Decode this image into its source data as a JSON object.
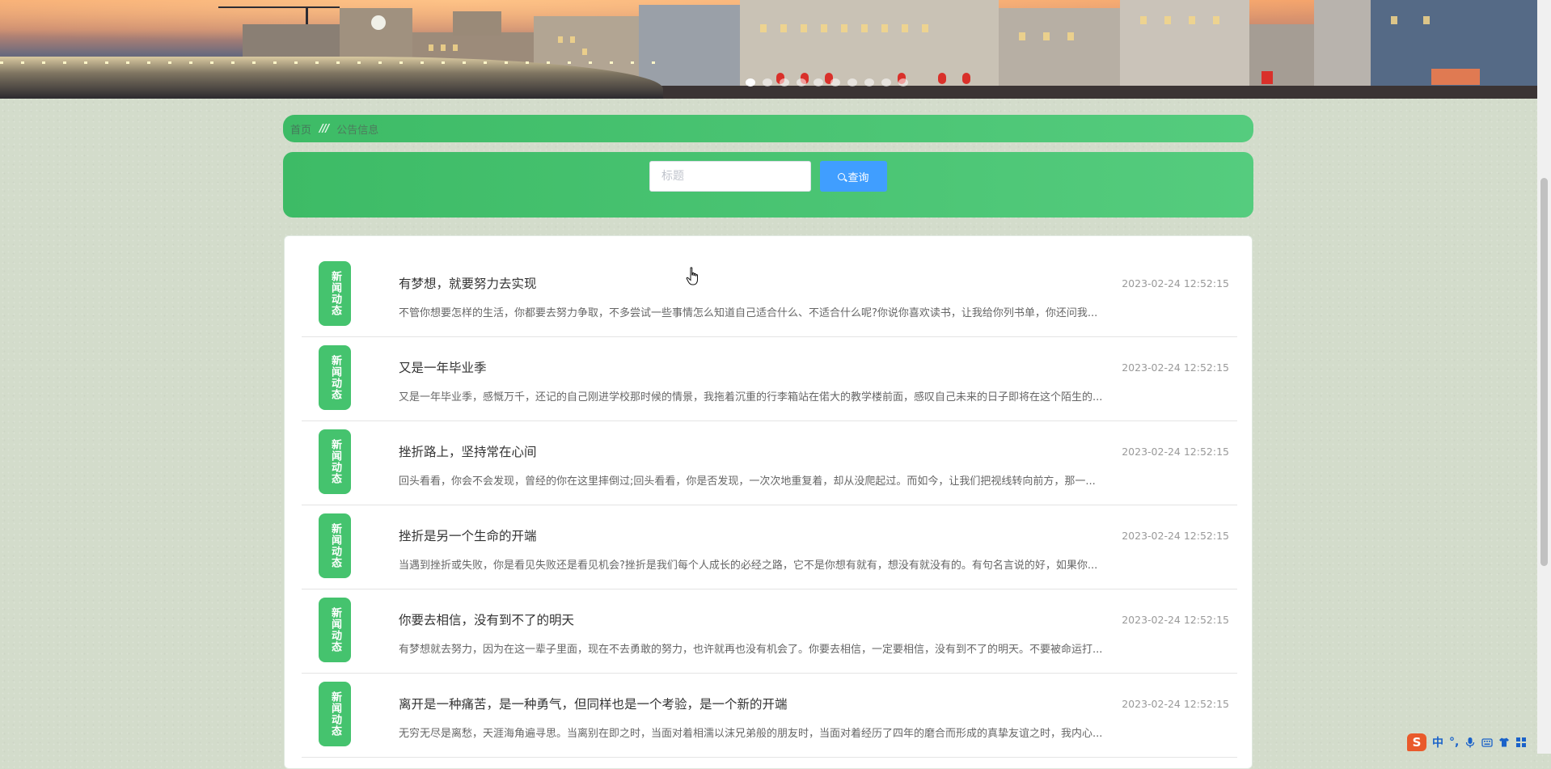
{
  "breadcrumb": {
    "home": "首页",
    "separator": "///",
    "current": "公告信息"
  },
  "search": {
    "placeholder": "标题",
    "value": "",
    "button_label": "查询"
  },
  "carousel": {
    "slide_count": 10,
    "active_index": 0
  },
  "news": {
    "items": [
      {
        "badge": "新闻动态",
        "title": "有梦想，就要努力去实现",
        "date": "2023-02-24 12:52:15",
        "summary": "不管你想要怎样的生活，你都要去努力争取，不多尝试一些事情怎么知道自己适合什么、不适合什么呢?你说你喜欢读书，让我给你列书单，你还问我..."
      },
      {
        "badge": "新闻动态",
        "title": "又是一年毕业季",
        "date": "2023-02-24 12:52:15",
        "summary": "又是一年毕业季，感慨万千，还记的自己刚进学校那时候的情景，我拖着沉重的行李箱站在偌大的教学楼前面，感叹自己未来的日子即将在这个陌生的..."
      },
      {
        "badge": "新闻动态",
        "title": "挫折路上，坚持常在心间",
        "date": "2023-02-24 12:52:15",
        "summary": "回头看看，你会不会发现，曾经的你在这里摔倒过;回头看看，你是否发现，一次次地重复着，却从没爬起过。而如今，让我们把视线转向前方，那一..."
      },
      {
        "badge": "新闻动态",
        "title": "挫折是另一个生命的开端",
        "date": "2023-02-24 12:52:15",
        "summary": "当遇到挫折或失败，你是看见失败还是看见机会?挫折是我们每个人成长的必经之路，它不是你想有就有，想没有就没有的。有句名言说的好，如果你..."
      },
      {
        "badge": "新闻动态",
        "title": "你要去相信，没有到不了的明天",
        "date": "2023-02-24 12:52:15",
        "summary": "有梦想就去努力，因为在这一辈子里面，现在不去勇敢的努力，也许就再也没有机会了。你要去相信，一定要相信，没有到不了的明天。不要被命运打..."
      },
      {
        "badge": "新闻动态",
        "title": "离开是一种痛苦，是一种勇气，但同样也是一个考验，是一个新的开端",
        "date": "2023-02-24 12:52:15",
        "summary": "无穷无尽是离愁，天涯海角遍寻思。当离别在即之时，当面对着相濡以沫兄弟般的朋友时，当面对着经历了四年的磨合而形成的真挚友谊之时，我内心..."
      }
    ]
  },
  "ime": {
    "logo": "S",
    "mode": "中",
    "punct": "°,"
  },
  "colors": {
    "accent_green": "#45c36e",
    "search_blue": "#409eff",
    "page_bg": "#d3dccb"
  }
}
